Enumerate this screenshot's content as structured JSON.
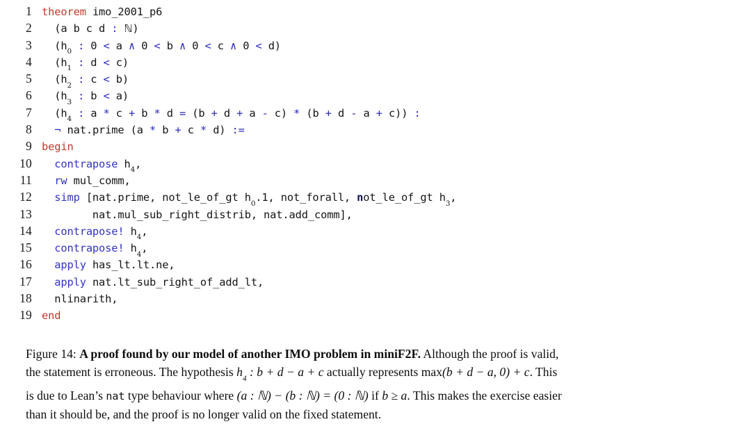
{
  "figure": {
    "label": "Figure 14:",
    "title": "A proof found by our model of another IMO problem in miniF2F.",
    "body_part1": "Although the proof is valid,",
    "body_line2_pre": "the statement is erroneous. The hypothesis ",
    "body_line2_math_h": "h",
    "body_line2_math_h_sub": "4",
    "body_line2_math_expr": " : b + d − a + c",
    "body_line2_mid": " actually represents ",
    "body_line2_max": "max",
    "body_line2_max_expr": "(b + d − a, 0) + c",
    "body_line2_end": ". This",
    "body_line3_pre": "is due to Lean’s ",
    "body_line3_mono": "nat",
    "body_line3_mid": " type behaviour where ",
    "body_line3_math1": "(a : ℕ) − (b : ℕ) = (0 : ℕ)",
    "body_line3_if": " if ",
    "body_line3_math2": "b ≥ a",
    "body_line3_end": ". This makes the exercise easier",
    "body_line4": "than it should be, and the proof is no longer valid on the fixed statement."
  },
  "code": {
    "language": "lean",
    "line_numbers": [
      "1",
      "2",
      "3",
      "4",
      "5",
      "6",
      "7",
      "8",
      "9",
      "10",
      "11",
      "12",
      "13",
      "14",
      "15",
      "16",
      "17",
      "18",
      "19"
    ],
    "lines": [
      {
        "n": "1",
        "text": "theorem imo_2001_p6"
      },
      {
        "n": "2",
        "text": "  (a b c d : ℕ)"
      },
      {
        "n": "3",
        "text": "  (h₀ : 0 < a ∧ 0 < b ∧ 0 < c ∧ 0 < d)"
      },
      {
        "n": "4",
        "text": "  (h₁ : d < c)"
      },
      {
        "n": "5",
        "text": "  (h₂ : c < b)"
      },
      {
        "n": "6",
        "text": "  (h₃ : b < a)"
      },
      {
        "n": "7",
        "text": "  (h₄ : a * c + b * d = (b + d + a - c) * (b + d - a + c)) :"
      },
      {
        "n": "8",
        "text": "  ¬ nat.prime (a * b + c * d) :="
      },
      {
        "n": "9",
        "text": "begin"
      },
      {
        "n": "10",
        "text": "  contrapose h₄,"
      },
      {
        "n": "11",
        "text": "  rw mul_comm,"
      },
      {
        "n": "12",
        "text": "  simp [nat.prime, not_le_of_gt h₀.1, not_forall, not_le_of_gt h₃,"
      },
      {
        "n": "13",
        "text": "        nat.mul_sub_right_distrib, nat.add_comm],"
      },
      {
        "n": "14",
        "text": "  contrapose! h₄,"
      },
      {
        "n": "15",
        "text": "  contrapose! h₄,"
      },
      {
        "n": "16",
        "text": "  apply has_lt.lt.ne,"
      },
      {
        "n": "17",
        "text": "  apply nat.lt_sub_right_of_add_lt,"
      },
      {
        "n": "18",
        "text": "  nlinarith,"
      },
      {
        "n": "19",
        "text": "end"
      }
    ],
    "colors": {
      "keyword": "#c0392b",
      "tactic": "#3333c0",
      "operator": "#2a2ab8",
      "identifier": "#141414",
      "background": "#ffffff"
    }
  }
}
